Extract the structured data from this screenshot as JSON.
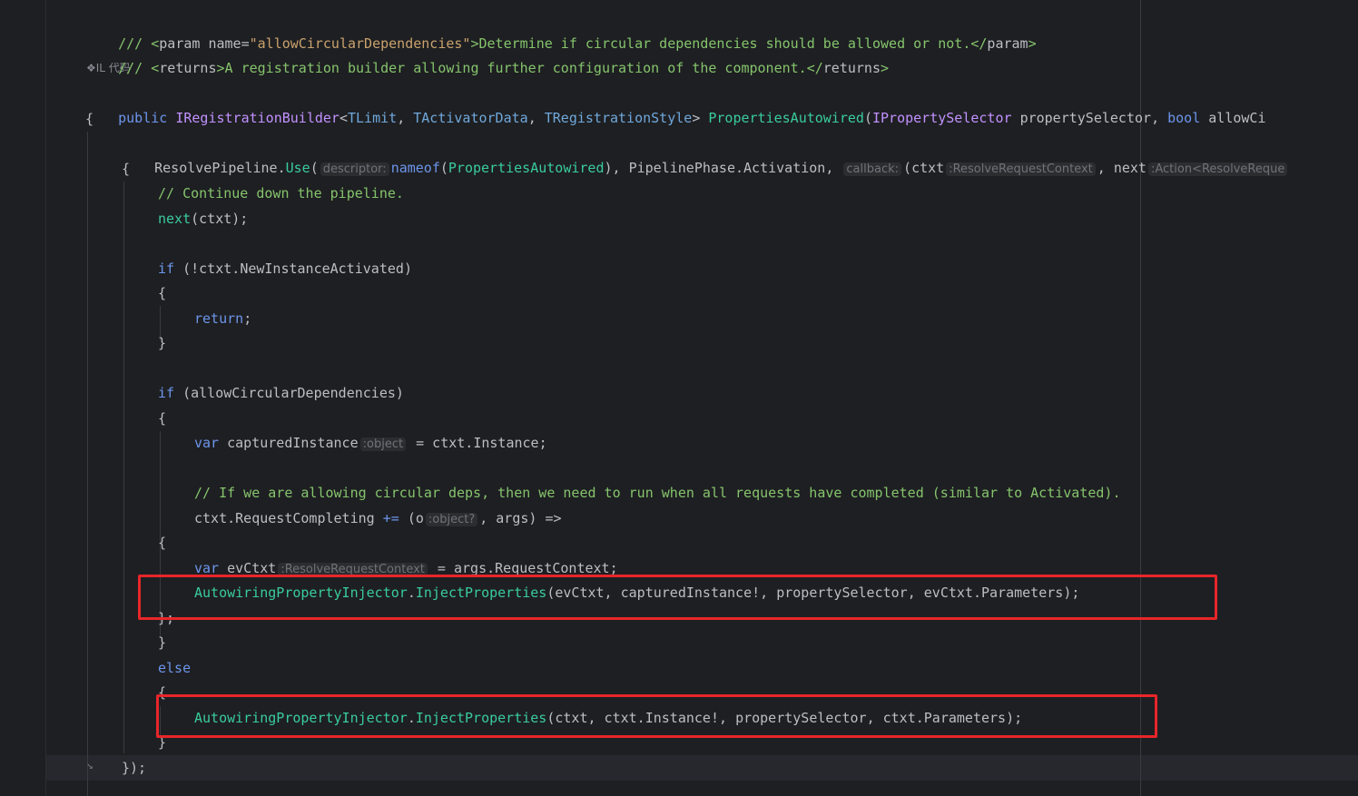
{
  "inlay_il": "❖IL 代码",
  "lines": {
    "l0": {
      "a": "/// ",
      "b": "<",
      "c": "param",
      " d": "",
      "e": " name=",
      "f": "\"allowCircularDependencies\"",
      "g": ">Determine if circular dependencies should be allowed or not.</",
      "h": "param",
      "i": ">"
    },
    "l1": {
      "a": "/// ",
      "b": "<",
      "c": "returns",
      "d": ">A registration builder allowing further configuration of the component.</",
      "e": "returns",
      "f": ">"
    },
    "l2": {
      "kw": "public ",
      "t1": "IRegistrationBuilder",
      "lt": "<",
      "g1": "TLimit",
      ", ": ", ",
      "g2": "TActivatorData",
      "g3": "TRegistrationStyle",
      "gt": "> ",
      "m": "PropertiesAutowired",
      "op": "(",
      "t2": "IPropertySelector ",
      "p1": "propertySelector",
      ", 2": ", ",
      "kw2": "bool ",
      "p2": "allowCi"
    },
    "l3": "{",
    "l4": {
      "t": "ResolvePipeline",
      ".": ".",
      "m": "Use",
      "op": "(",
      "h1": "descriptor:",
      "nf": "nameof",
      "op2": "(",
      "m2": "PropertiesAutowired",
      "cp": "), ",
      "t2": "PipelinePhase",
      ".2": ".",
      "mem": "Activation",
      ",": ", ",
      "h2": "callback:",
      "op3": "(",
      "p": "ctxt",
      "h3": ":ResolveRequestContext",
      ",2": ", ",
      "p2": "next",
      "h4": ":Action<ResolveReque"
    },
    "l5": "{",
    "l6": "// Continue down the pipeline.",
    "l7": {
      "m": "next",
      "rest": "(ctxt);"
    },
    "l8": {
      "kw": "if ",
      "rest": "(!ctxt.",
      "mem": "NewInstanceActivated",
      ")": ")"
    },
    "l9": "{",
    "l10": {
      "kw": "return",
      ";": ";"
    },
    "l11": "}",
    "l12": {
      "kw": "if ",
      "op": "(",
      "p": "allowCircularDependencies",
      ")": ")"
    },
    "l13": "{",
    "l14": {
      "kw": "var ",
      "v": "capturedInstance",
      "h": ":object",
      "rest": " = ctxt.",
      "mem": "Instance",
      ";": ";"
    },
    "l15": "// If we are allowing circular deps, then we need to run when all requests have completed (similar to Activated).",
    "l16": {
      "a": "ctxt.",
      "mem": "RequestCompleting",
      "op": " += ",
      "p": "(o",
      "h": ":object?",
      ",": ", ",
      "a2": "args",
      ")": ") =>"
    },
    "l17": "{",
    "l18": {
      "kw": "var ",
      "v": "evCtxt",
      "h": ":ResolveRequestContext",
      "rest": " = args.",
      "mem": "RequestContext",
      ";": ";"
    },
    "l19": {
      "t": "AutowiringPropertyInjector",
      ".": ".",
      "m": "InjectProperties",
      "rest": "(evCtxt, capturedInstance!, ",
      "p": "propertySelector",
      ", ": ", evCtxt.",
      "mem": "Parameters",
      "end": ");"
    },
    "l20": "};",
    "l21": "}",
    "l22": {
      "kw": "else"
    },
    "l23": "{",
    "l24": {
      "t": "AutowiringPropertyInjector",
      ".": ".",
      "m": "InjectProperties",
      "rest": "(ctxt, ctxt.",
      "mem": "Instance",
      "mid": "!, ",
      "p": "propertySelector",
      ", ": ", ctxt.",
      "mem2": "Parameters",
      "end": ");"
    },
    "l25": "}",
    "l26": "});"
  },
  "colors": {
    "accent_box": "#e8262a",
    "background": "#1e1f22"
  }
}
